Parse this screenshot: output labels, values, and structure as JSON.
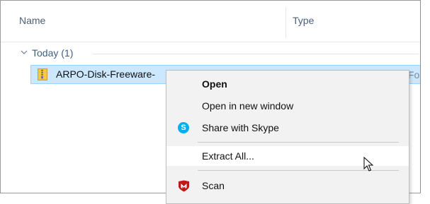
{
  "columns": {
    "name": "Name",
    "type": "Type"
  },
  "group": {
    "label": "Today (1)"
  },
  "file": {
    "name": "ARPO-Disk-Freeware-",
    "type": "Fol"
  },
  "context_menu": {
    "items": [
      {
        "label": "Open",
        "bold": true
      },
      {
        "label": "Open in new window"
      },
      {
        "label": "Share with Skype",
        "icon": "skype-icon"
      },
      {
        "label": "Extract All...",
        "hovered": true
      },
      {
        "label": "Scan",
        "icon": "mcafee-icon"
      }
    ]
  },
  "colors": {
    "selection_bg": "#cce8ff",
    "selection_border": "#99d1ff",
    "menu_bg": "#f2f2f2",
    "skype": "#00aff0",
    "mcafee": "#c01818"
  }
}
